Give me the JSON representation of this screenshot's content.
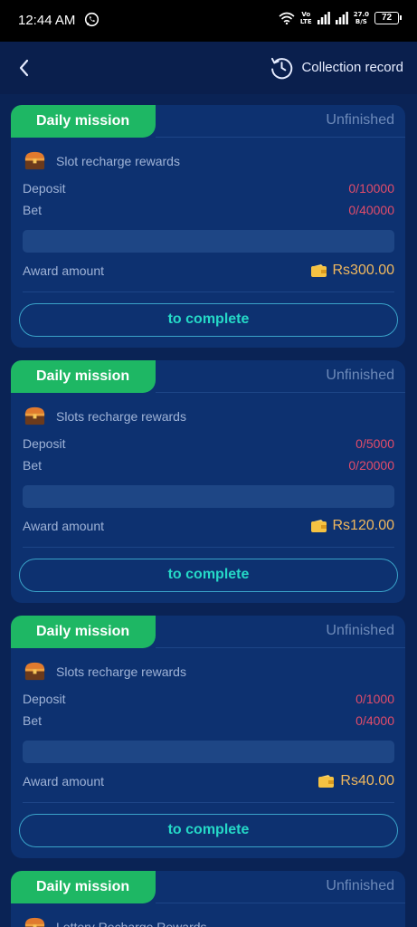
{
  "status_bar": {
    "time": "12:44 AM",
    "net_top": "Vo",
    "net_bottom": "LTE",
    "speed_top": "27.0",
    "speed_bottom": "B/S",
    "battery": "72"
  },
  "header": {
    "collection_record": "Collection record",
    "icons": {
      "back": "chevron-left-icon",
      "history": "history-clock-icon"
    }
  },
  "labels": {
    "deposit": "Deposit",
    "bet": "Bet",
    "award": "Award amount",
    "complete": "to complete"
  },
  "colors": {
    "accent_green": "#1eb764",
    "progress_red": "#e14c6a",
    "award_gold": "#f0b85e",
    "button_text": "#25d9c7",
    "card_bg": "#0d3170"
  },
  "missions": [
    {
      "tag": "Daily mission",
      "status": "Unfinished",
      "title": "Slot recharge rewards",
      "deposit": "0/10000",
      "bet": "0/40000",
      "progress": 0,
      "award": "Rs300.00"
    },
    {
      "tag": "Daily mission",
      "status": "Unfinished",
      "title": "Slots recharge rewards",
      "deposit": "0/5000",
      "bet": "0/20000",
      "progress": 0,
      "award": "Rs120.00"
    },
    {
      "tag": "Daily mission",
      "status": "Unfinished",
      "title": "Slots recharge rewards",
      "deposit": "0/1000",
      "bet": "0/4000",
      "progress": 0,
      "award": "Rs40.00"
    },
    {
      "tag": "Daily mission",
      "status": "Unfinished",
      "title": "Lottery Recharge Rewards"
    }
  ]
}
